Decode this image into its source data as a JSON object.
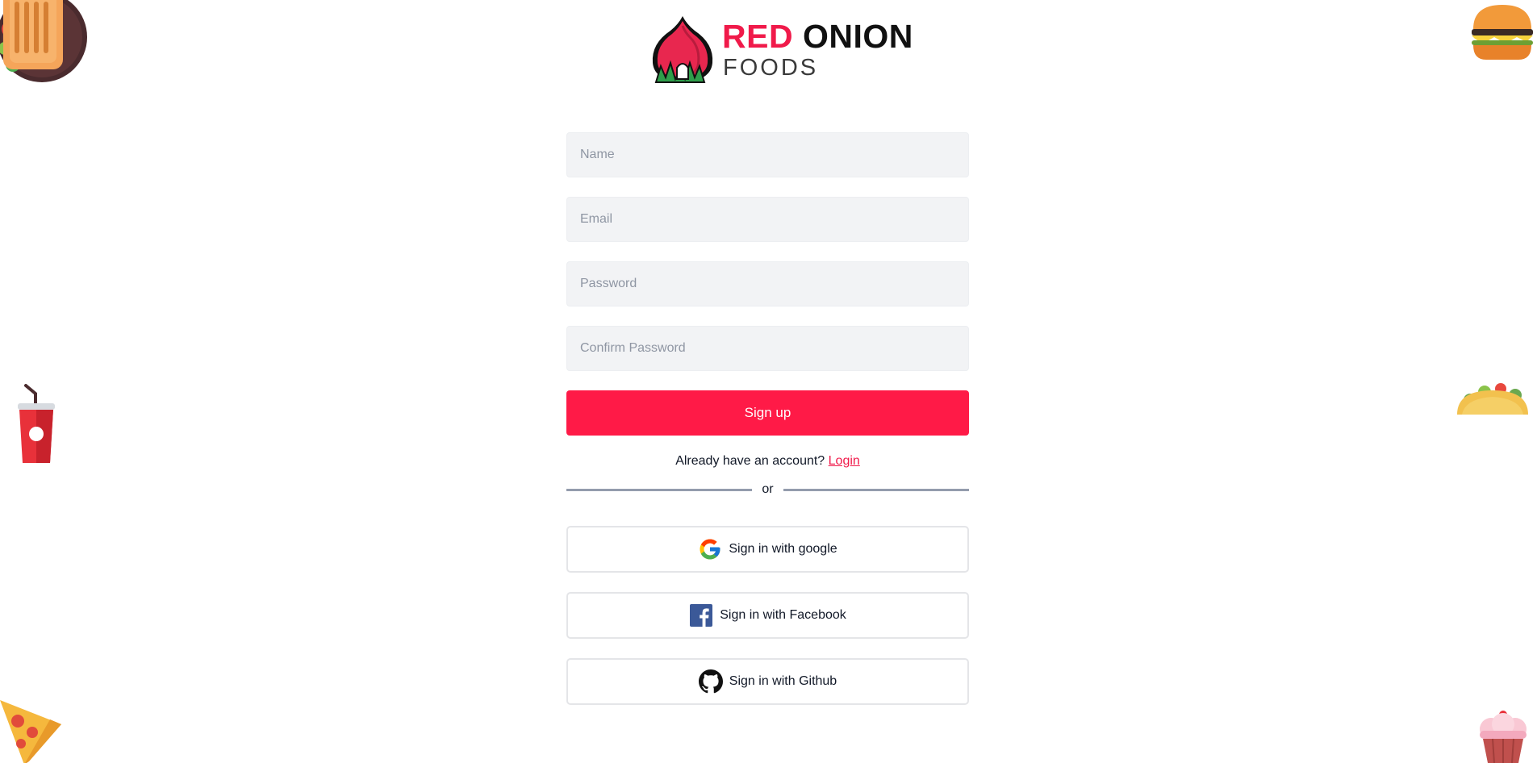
{
  "brand": {
    "name_red": "RED",
    "name_dark": "ONION",
    "subtitle": "FOODS",
    "accent_color": "#f01a4a"
  },
  "form": {
    "name_placeholder": "Name",
    "email_placeholder": "Email",
    "password_placeholder": "Password",
    "confirm_password_placeholder": "Confirm Password",
    "signup_label": "Sign up",
    "signup_color": "#ff1a47"
  },
  "login_prompt": {
    "text": "Already have an account?",
    "link_label": "Login"
  },
  "divider": {
    "text": "or"
  },
  "social": {
    "google_label": "Sign in with google",
    "facebook_label": "Sign in with Facebook",
    "github_label": "Sign in with Github"
  },
  "decorations": {
    "top_left": "sandwich-icon",
    "top_right": "burger-icon",
    "mid_left": "soda-cup-icon",
    "mid_right": "taco-icon",
    "bottom_left": "pizza-slice-icon",
    "bottom_right": "cupcake-icon"
  }
}
